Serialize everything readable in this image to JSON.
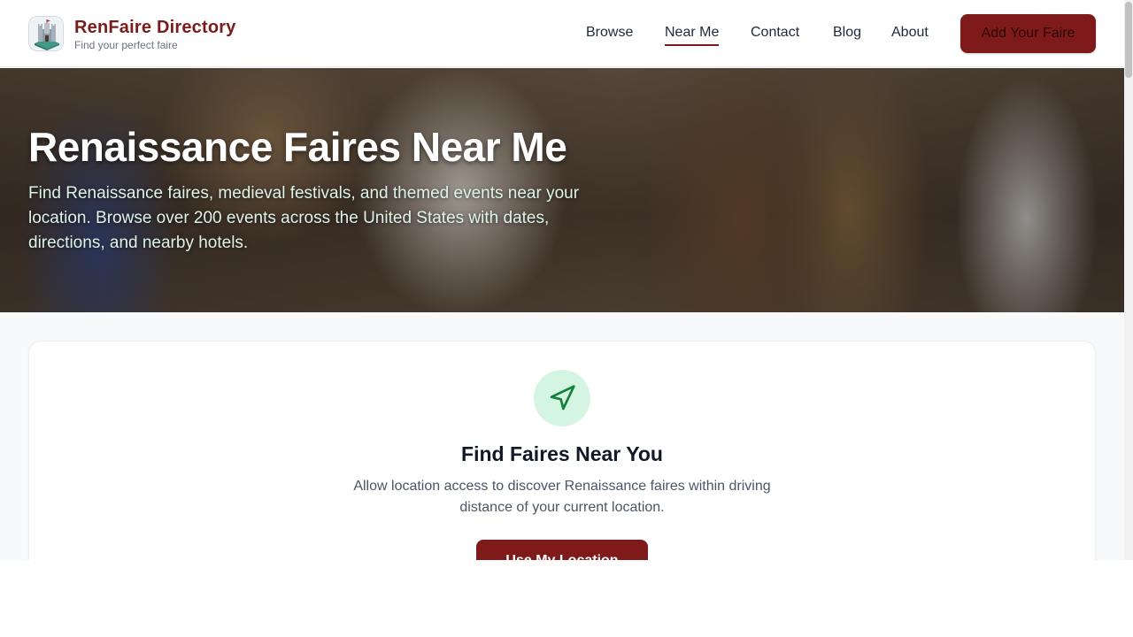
{
  "header": {
    "brand_name": "RenFaire Directory",
    "brand_tagline": "Find your perfect faire",
    "logo_icon": "castle-icon",
    "nav": [
      {
        "label": "Browse",
        "active": false
      },
      {
        "label": "Near Me",
        "active": true
      },
      {
        "label": "Contact",
        "active": false
      },
      {
        "label": "Blog",
        "active": false
      },
      {
        "label": "About",
        "active": false
      }
    ],
    "cta_label": "Add Your Faire"
  },
  "hero": {
    "title": "Renaissance Faires Near Me",
    "subtitle": "Find Renaissance faires, medieval festivals, and themed events near your location. Browse over 200 events across the United States with dates, directions, and nearby hotels."
  },
  "locator": {
    "icon": "navigation-arrow-icon",
    "title": "Find Faires Near You",
    "description": "Allow location access to discover Renaissance faires within driving distance of your current location.",
    "button_label": "Use My Location"
  },
  "colors": {
    "brand": "#7a1c1c",
    "button": "#7f1a1a",
    "icon_bg": "#d5f5e3",
    "icon_stroke": "#15803d",
    "page_bg": "#f8f9fb"
  }
}
